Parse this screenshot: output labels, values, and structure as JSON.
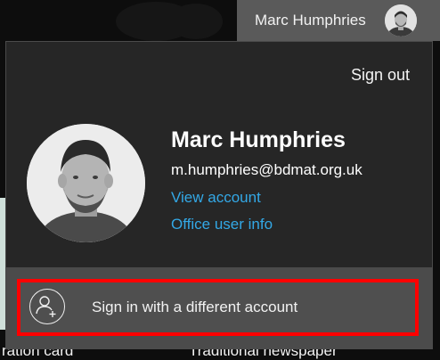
{
  "top_bar": {
    "account_name": "Marc Humphries"
  },
  "account_menu": {
    "sign_out_label": "Sign out",
    "user": {
      "name": "Marc Humphries",
      "email": "m.humphries@bdmat.org.uk"
    },
    "links": {
      "view_account": "View account",
      "office_user_info": "Office user info"
    },
    "other_account_label": "Sign in with a different account"
  },
  "background": {
    "left_card_caption": "ration card",
    "right_card_caption": "Traditional newspaper"
  },
  "colors": {
    "link": "#33a8e6",
    "panel": "#262626",
    "highlight_border": "#ff0000",
    "account_button": "#5a5a5a"
  },
  "icons": {
    "add_person": "add-person-icon"
  }
}
